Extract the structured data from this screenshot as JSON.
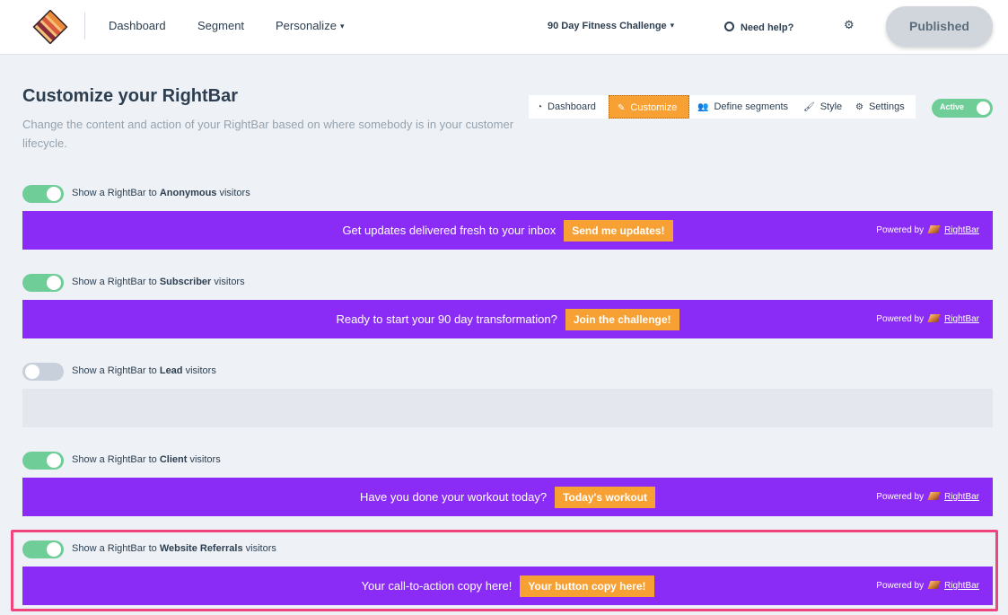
{
  "topnav": {
    "logo": "rightbar-logo",
    "links": [
      "Dashboard",
      "Segment",
      "Personalize"
    ],
    "project": "90 Day Fitness Challenge",
    "help": "Need help?",
    "publish_label": "Published"
  },
  "header": {
    "title": "Customize your RightBar",
    "subtitle": "Change the content and action of your RightBar based on where somebody is in your customer lifecycle."
  },
  "tabs": [
    {
      "label": "Dashboard",
      "icon": "gauge-icon"
    },
    {
      "label": "Customize",
      "icon": "pencil-icon"
    },
    {
      "label": "Define segments",
      "icon": "users-icon"
    },
    {
      "label": "Style",
      "icon": "brush-icon"
    },
    {
      "label": "Settings",
      "icon": "gear-icon"
    }
  ],
  "active_tab": "Customize",
  "status_toggle": {
    "label": "Active",
    "on": true
  },
  "segments": [
    {
      "prefix": "Show a RightBar to",
      "name": "Anonymous",
      "suffix": "visitors",
      "enabled": true,
      "message": "Get updates delivered fresh to your inbox",
      "button": "Send me updates!",
      "powered_by": "Powered by",
      "brand": "RightBar"
    },
    {
      "prefix": "Show a RightBar to",
      "name": "Subscriber",
      "suffix": "visitors",
      "enabled": true,
      "message": "Ready to start your 90 day transformation?",
      "button": "Join the challenge!",
      "powered_by": "Powered by",
      "brand": "RightBar"
    },
    {
      "prefix": "Show a RightBar to",
      "name": "Lead",
      "suffix": "visitors",
      "enabled": false
    },
    {
      "prefix": "Show a RightBar to",
      "name": "Client",
      "suffix": "visitors",
      "enabled": true,
      "message": "Have you done your workout today?",
      "button": "Today's workout",
      "powered_by": "Powered by",
      "brand": "RightBar"
    },
    {
      "prefix": "Show a RightBar to",
      "name": "Website Referrals",
      "suffix": "visitors",
      "enabled": true,
      "message": "Your call-to-action copy here!",
      "button": "Your button copy here!",
      "powered_by": "Powered by",
      "brand": "RightBar"
    }
  ],
  "colors": {
    "bar": "#8a2cf5",
    "accent": "#f7a135",
    "toggle_on": "#6fce98",
    "toggle_off": "#c8d1db",
    "highlight": "#f0447c"
  }
}
